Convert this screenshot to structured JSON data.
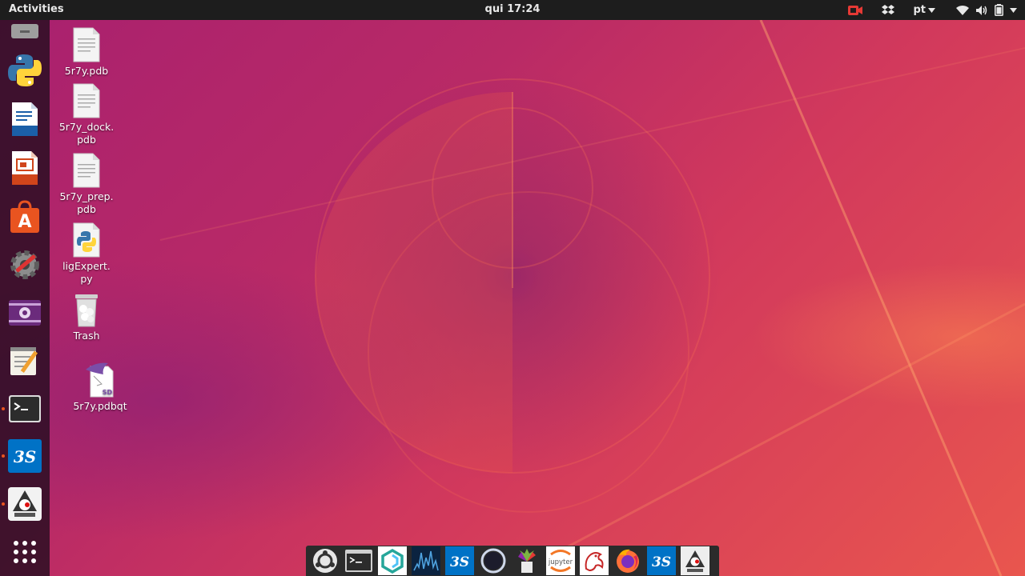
{
  "topbar": {
    "activities_label": "Activities",
    "clock": "qui 17:24",
    "language": "pt"
  },
  "dock": {
    "items": [
      {
        "name": "files",
        "icon": "drive-icon"
      },
      {
        "name": "python",
        "icon": "python-icon"
      },
      {
        "name": "libreoffice-writer",
        "icon": "writer-icon"
      },
      {
        "name": "libreoffice-impress",
        "icon": "impress-icon"
      },
      {
        "name": "ubuntu-software",
        "icon": "software-center-icon"
      },
      {
        "name": "system-tools",
        "icon": "settings-tools-icon"
      },
      {
        "name": "video",
        "icon": "video-player-icon"
      },
      {
        "name": "text-editor",
        "icon": "text-editor-icon"
      },
      {
        "name": "terminal",
        "icon": "terminal-icon",
        "running": true
      },
      {
        "name": "discovery-studio",
        "icon": "discovery-studio-icon",
        "running": true
      },
      {
        "name": "jmol",
        "icon": "jmol-icon",
        "running": true
      },
      {
        "name": "show-applications",
        "icon": "app-grid-icon"
      }
    ]
  },
  "desktop": {
    "icons": [
      {
        "label": "5r7y.pdb",
        "icon": "text-file-icon"
      },
      {
        "label": "5r7y_dock.\npdb",
        "icon": "text-file-icon"
      },
      {
        "label": "5r7y_prep.\npdb",
        "icon": "text-file-icon"
      },
      {
        "label": "ligExpert.\npy",
        "icon": "python-file-icon"
      },
      {
        "label": "Trash",
        "icon": "trash-icon"
      },
      {
        "label": "5r7y.pdbqt",
        "icon": "sd-file-icon"
      }
    ]
  },
  "taskbar": {
    "items": [
      {
        "name": "ubuntu",
        "icon": "ubuntu-logo-icon"
      },
      {
        "name": "terminal",
        "icon": "terminal-window-icon"
      },
      {
        "name": "app-3",
        "icon": "hexagon-app-icon"
      },
      {
        "name": "app-4",
        "icon": "spectrum-app-icon"
      },
      {
        "name": "discovery-studio",
        "icon": "discovery-studio-icon"
      },
      {
        "name": "app-6",
        "icon": "ring-app-icon"
      },
      {
        "name": "app-7",
        "icon": "flower-app-icon"
      },
      {
        "name": "jupyter",
        "icon": "jupyter-icon",
        "label": "jupyter"
      },
      {
        "name": "app-9",
        "icon": "dragon-app-icon"
      },
      {
        "name": "firefox",
        "icon": "firefox-icon"
      },
      {
        "name": "discovery-studio-2",
        "icon": "discovery-studio-icon"
      },
      {
        "name": "jmol",
        "icon": "jmol-icon"
      }
    ]
  },
  "colors": {
    "accent": "#e95420",
    "topbar": "#1d1d1d",
    "dock": "#260e20"
  }
}
